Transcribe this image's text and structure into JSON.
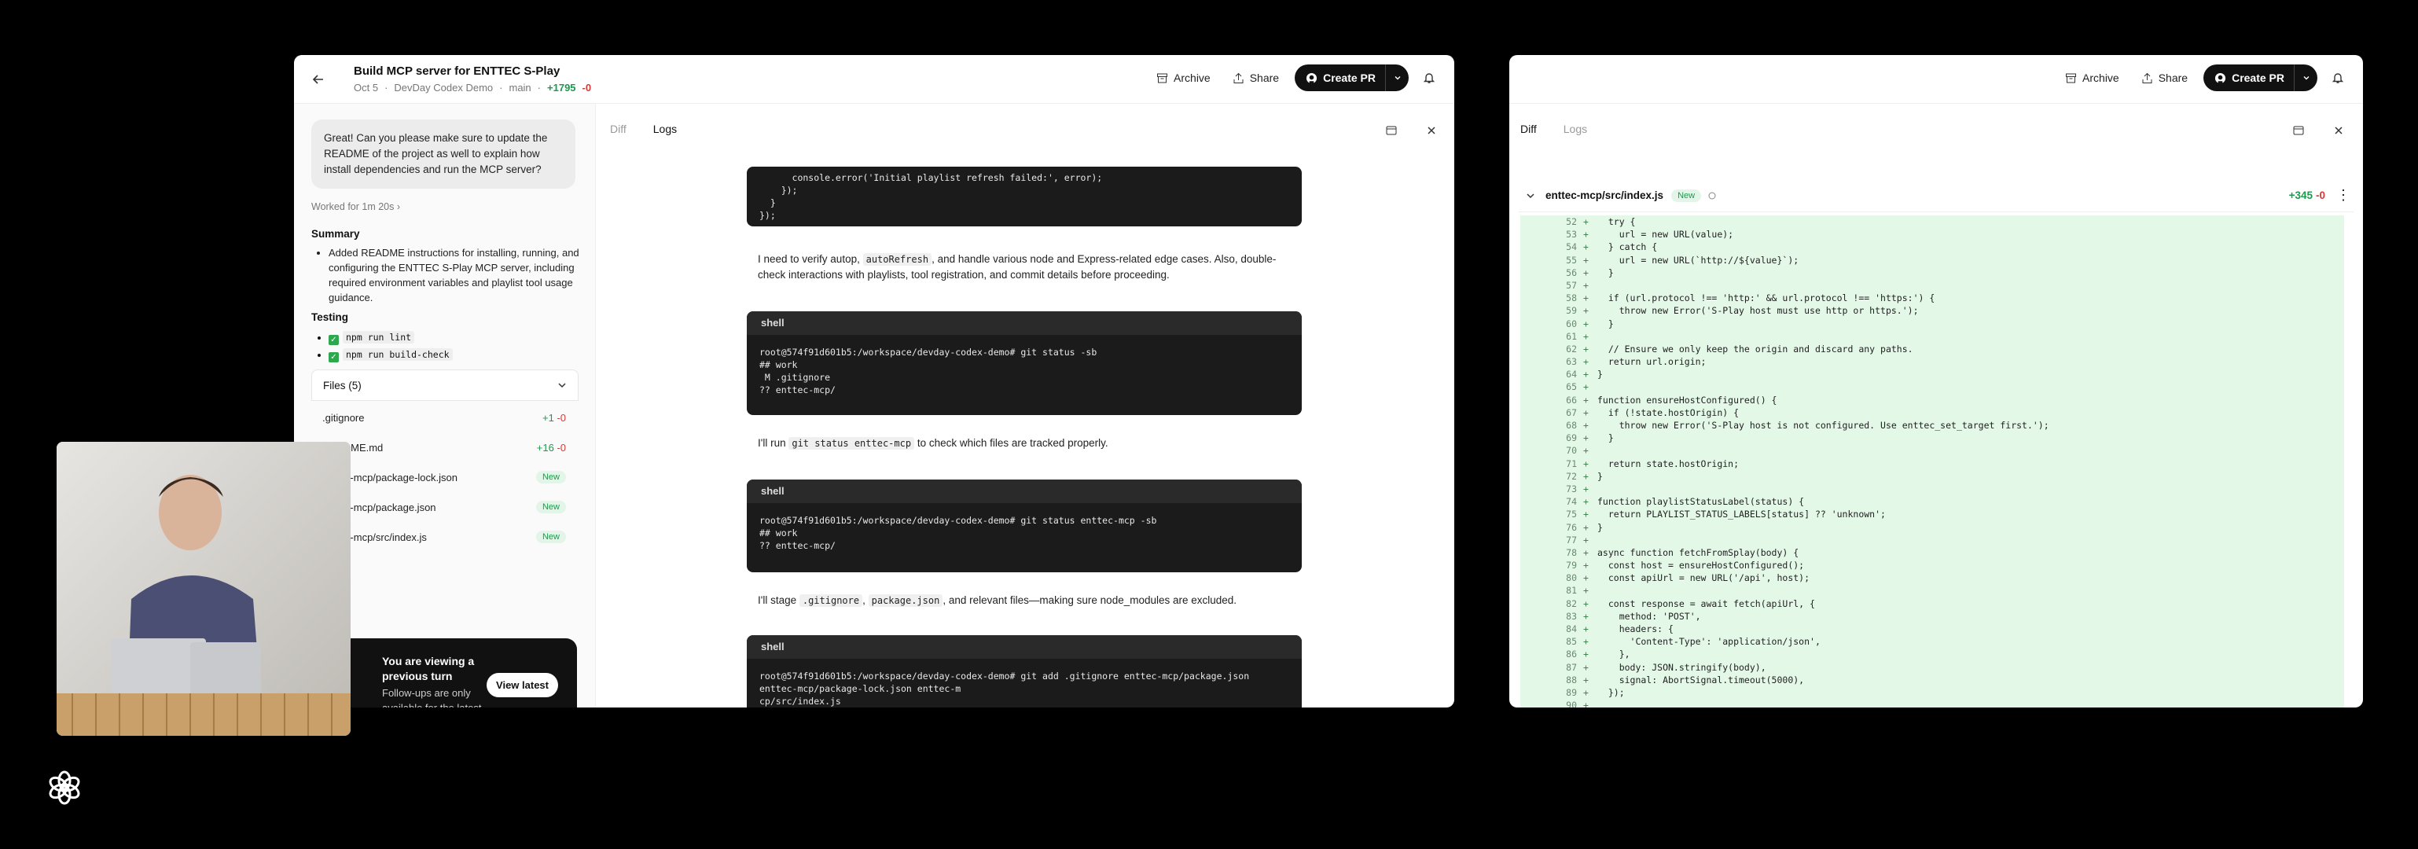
{
  "left": {
    "title": "Build MCP server for ENTTEC S-Play",
    "meta_date": "Oct 5",
    "meta_project": "DevDay Codex Demo",
    "meta_branch": "main",
    "meta_plus": "+1795",
    "meta_minus": "-0",
    "archive": "Archive",
    "share": "Share",
    "create_pr": "Create PR",
    "user_msg": "Great! Can you please make sure to update the README of the project as well to explain how install dependencies and run the MCP server?",
    "worked": "Worked for 1m 20s",
    "summary_h": "Summary",
    "summary_text": "Added README instructions for installing, running, and configuring the ENTTEC S-Play MCP server, including required environment variables and playlist tool usage guidance.",
    "testing_h": "Testing",
    "test1": "npm run lint",
    "test2": "npm run build-check",
    "files_label": "Files (5)",
    "files": [
      {
        "name": ".gitignore",
        "plus": "+1",
        "minus": "-0"
      },
      {
        "name": "README.md",
        "plus": "+16",
        "minus": "-0"
      },
      {
        "name": "enttec-mcp/package-lock.json",
        "badge": "New"
      },
      {
        "name": "enttec-mcp/package.json",
        "badge": "New"
      },
      {
        "name": "enttec-mcp/src/index.js",
        "badge": "New"
      }
    ],
    "prev_title": "You are viewing a previous turn",
    "prev_sub": "Follow-ups are only available for the latest turn",
    "view_latest": "View latest",
    "tab_diff": "Diff",
    "tab_logs": "Logs",
    "block0": "      console.error('Initial playlist refresh failed:', error);\n    });\n  }\n});",
    "narr1_a": "I need to verify autop, ",
    "narr1_code": "autoRefresh",
    "narr1_b": ", and handle various node and Express-related edge cases. Also, double-check interactions with playlists, tool registration, and commit details before proceeding.",
    "shell": "shell",
    "block1": "root@574f91d601b5:/workspace/devday-codex-demo# git status -sb\n## work\n M .gitignore\n?? enttec-mcp/",
    "narr2_a": "I'll run ",
    "narr2_code": "git status enttec-mcp",
    "narr2_b": " to check which files are tracked properly.",
    "block2": "root@574f91d601b5:/workspace/devday-codex-demo# git status enttec-mcp -sb\n## work\n?? enttec-mcp/",
    "narr3_a": "I'll stage ",
    "narr3_code1": ".gitignore",
    "narr3_mid": ", ",
    "narr3_code2": "package.json",
    "narr3_b": ", and relevant files—making sure node_modules are excluded.",
    "block3": "root@574f91d601b5:/workspace/devday-codex-demo# git add .gitignore enttec-mcp/package.json\nenttec-mcp/package-lock.json enttec-m\ncp/src/index.js"
  },
  "right": {
    "archive": "Archive",
    "share": "Share",
    "create_pr": "Create PR",
    "tab_diff": "Diff",
    "tab_logs": "Logs",
    "file_path": "enttec-mcp/src/index.js",
    "file_badge": "New",
    "file_plus": "+345",
    "file_minus": "-0",
    "lines": [
      {
        "n": "52",
        "t": "  try {"
      },
      {
        "n": "53",
        "t": "    url = new URL(value);"
      },
      {
        "n": "54",
        "t": "  } catch {"
      },
      {
        "n": "55",
        "t": "    url = new URL(`http://${value}`);"
      },
      {
        "n": "56",
        "t": "  }"
      },
      {
        "n": "57",
        "t": ""
      },
      {
        "n": "58",
        "t": "  if (url.protocol !== 'http:' && url.protocol !== 'https:') {"
      },
      {
        "n": "59",
        "t": "    throw new Error('S-Play host must use http or https.');"
      },
      {
        "n": "60",
        "t": "  }"
      },
      {
        "n": "61",
        "t": ""
      },
      {
        "n": "62",
        "t": "  // Ensure we only keep the origin and discard any paths."
      },
      {
        "n": "63",
        "t": "  return url.origin;"
      },
      {
        "n": "64",
        "t": "}"
      },
      {
        "n": "65",
        "t": ""
      },
      {
        "n": "66",
        "t": "function ensureHostConfigured() {"
      },
      {
        "n": "67",
        "t": "  if (!state.hostOrigin) {"
      },
      {
        "n": "68",
        "t": "    throw new Error('S-Play host is not configured. Use enttec_set_target first.');"
      },
      {
        "n": "69",
        "t": "  }"
      },
      {
        "n": "70",
        "t": ""
      },
      {
        "n": "71",
        "t": "  return state.hostOrigin;"
      },
      {
        "n": "72",
        "t": "}"
      },
      {
        "n": "73",
        "t": ""
      },
      {
        "n": "74",
        "t": "function playlistStatusLabel(status) {"
      },
      {
        "n": "75",
        "t": "  return PLAYLIST_STATUS_LABELS[status] ?? 'unknown';"
      },
      {
        "n": "76",
        "t": "}"
      },
      {
        "n": "77",
        "t": ""
      },
      {
        "n": "78",
        "t": "async function fetchFromSplay(body) {"
      },
      {
        "n": "79",
        "t": "  const host = ensureHostConfigured();"
      },
      {
        "n": "80",
        "t": "  const apiUrl = new URL('/api', host);"
      },
      {
        "n": "81",
        "t": ""
      },
      {
        "n": "82",
        "t": "  const response = await fetch(apiUrl, {"
      },
      {
        "n": "83",
        "t": "    method: 'POST',"
      },
      {
        "n": "84",
        "t": "    headers: {"
      },
      {
        "n": "85",
        "t": "      'Content-Type': 'application/json',"
      },
      {
        "n": "86",
        "t": "    },"
      },
      {
        "n": "87",
        "t": "    body: JSON.stringify(body),"
      },
      {
        "n": "88",
        "t": "    signal: AbortSignal.timeout(5000),"
      },
      {
        "n": "89",
        "t": "  });"
      },
      {
        "n": "90",
        "t": ""
      }
    ]
  },
  "colors": {
    "accent_green": "#1a9b4b",
    "accent_red": "#d23b3b",
    "diff_bg": "#e3f8e7"
  }
}
